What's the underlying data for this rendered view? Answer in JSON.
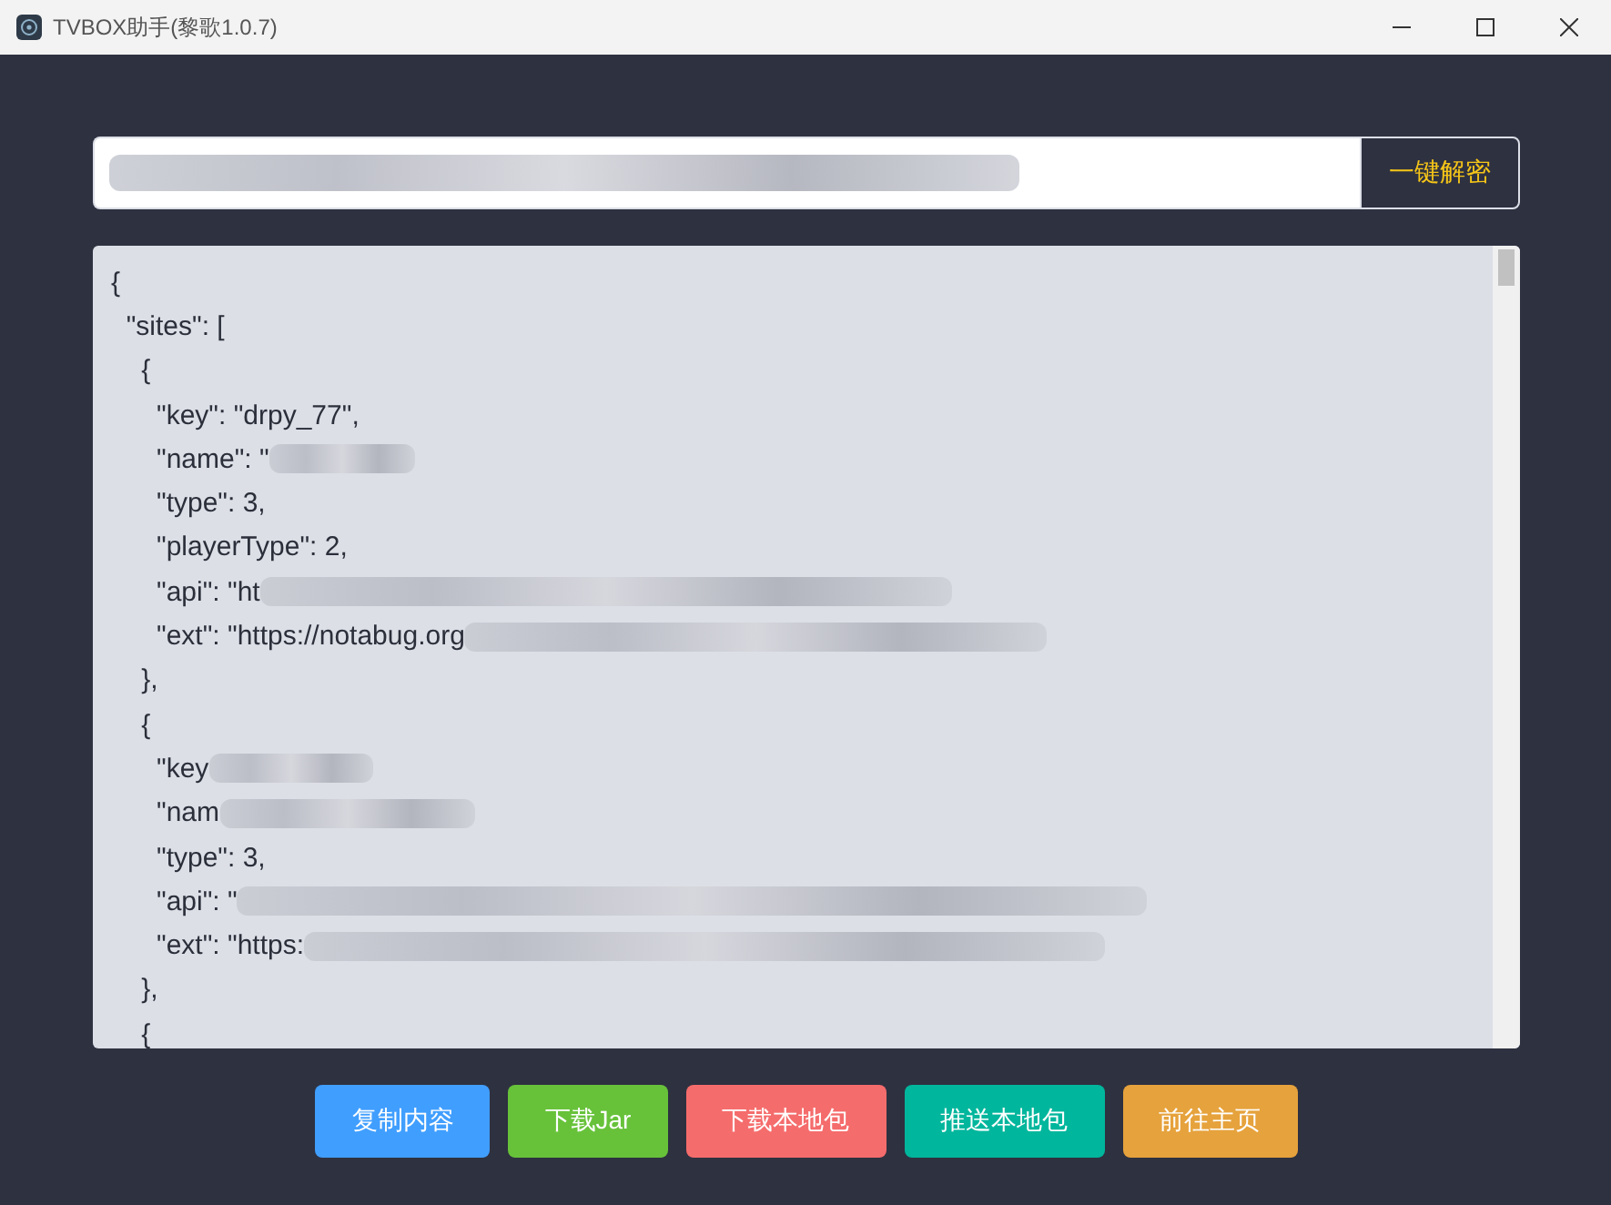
{
  "window": {
    "title": "TVBOX助手(黎歌1.0.7)"
  },
  "url_field": {
    "redacted": true
  },
  "decrypt_button": {
    "label": "一键解密"
  },
  "editor": {
    "lines": [
      {
        "text": "{",
        "redacted": false
      },
      {
        "text": "  \"sites\": [",
        "redacted": false
      },
      {
        "text": "    {",
        "redacted": false
      },
      {
        "text": "      \"key\": \"drpy_77\",",
        "redacted": false
      },
      {
        "text": "      \"name\": \"",
        "redacted": true
      },
      {
        "text": "      \"type\": 3,",
        "redacted": false
      },
      {
        "text": "      \"playerType\": 2,",
        "redacted": false
      },
      {
        "text": "      \"api\": \"ht",
        "redacted": true
      },
      {
        "text": "      \"ext\": \"https://notabug.org",
        "redacted": true
      },
      {
        "text": "    },",
        "redacted": false
      },
      {
        "text": "    {",
        "redacted": false
      },
      {
        "text": "      \"key",
        "redacted": true
      },
      {
        "text": "      \"nam",
        "redacted": true
      },
      {
        "text": "      \"type\": 3,",
        "redacted": false
      },
      {
        "text": "      \"api\": \"",
        "redacted": true
      },
      {
        "text": "      \"ext\": \"https:",
        "redacted": true
      },
      {
        "text": "    },",
        "redacted": false
      },
      {
        "text": "    {",
        "redacted": false
      }
    ]
  },
  "buttons": [
    {
      "label": "复制内容",
      "color": "#409eff"
    },
    {
      "label": "下载Jar",
      "color": "#67c23a"
    },
    {
      "label": "下载本地包",
      "color": "#f56c6c"
    },
    {
      "label": "推送本地包",
      "color": "#00b69c"
    },
    {
      "label": "前往主页",
      "color": "#e6a23c"
    }
  ]
}
